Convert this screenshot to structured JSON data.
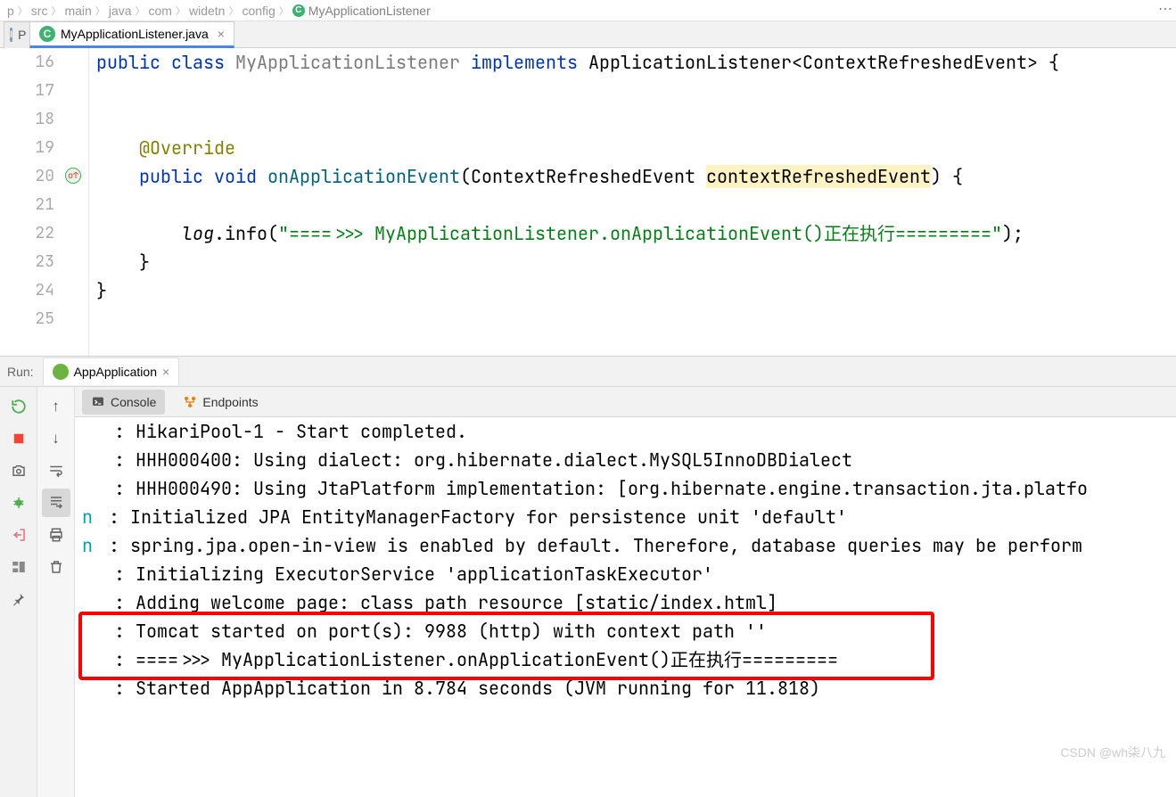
{
  "breadcrumb": {
    "items": [
      "p",
      "src",
      "main",
      "java",
      "com",
      "widetn",
      "config",
      "MyApplicationListener"
    ]
  },
  "tabs": {
    "inactive_label": "P",
    "active_file": "MyApplicationListener.java"
  },
  "editor": {
    "lines": [
      {
        "n": "16",
        "ind": "",
        "t": [
          [
            "kw",
            "public"
          ],
          [
            "sp",
            " "
          ],
          [
            "kw",
            "class"
          ],
          [
            "sp",
            " "
          ],
          [
            "cls",
            "MyApplicationListener"
          ],
          [
            "sp",
            " "
          ],
          [
            "kw",
            "implements"
          ],
          [
            "sp",
            " "
          ],
          [
            "p",
            "ApplicationListener<ContextRefreshedEvent> {"
          ]
        ]
      },
      {
        "n": "17",
        "ind": "",
        "t": []
      },
      {
        "n": "18",
        "ind": "",
        "t": []
      },
      {
        "n": "19",
        "ind": "    ",
        "t": [
          [
            "ann",
            "@Override"
          ]
        ]
      },
      {
        "n": "20",
        "ind": "    ",
        "t": [
          [
            "kw",
            "public"
          ],
          [
            "sp",
            " "
          ],
          [
            "kw",
            "void"
          ],
          [
            "sp",
            " "
          ],
          [
            "mname",
            "onApplicationEvent"
          ],
          [
            "p",
            "(ContextRefreshedEvent "
          ],
          [
            "hl",
            "contextRefreshedEvent"
          ],
          [
            "p",
            ") {"
          ]
        ],
        "override": true
      },
      {
        "n": "21",
        "ind": "",
        "t": []
      },
      {
        "n": "22",
        "ind": "        ",
        "t": [
          [
            "local",
            "log"
          ],
          [
            "p",
            ".info("
          ],
          [
            "str",
            "\"====>>> MyApplicationListener.onApplicationEvent()"
          ],
          [
            "strcn",
            "正在执行"
          ],
          [
            "str",
            "=========\""
          ],
          [
            "p",
            ");"
          ]
        ]
      },
      {
        "n": "23",
        "ind": "    ",
        "t": [
          [
            "p",
            "}"
          ]
        ]
      },
      {
        "n": "24",
        "ind": "",
        "t": [
          [
            "p",
            "}"
          ]
        ]
      },
      {
        "n": "25",
        "ind": "",
        "t": []
      }
    ]
  },
  "run": {
    "label": "Run:",
    "config": "AppApplication",
    "console_tab": "Console",
    "endpoints_tab": "Endpoints"
  },
  "console": {
    "lines": [
      " : HikariPool-1 - Start completed.",
      " : HHH000400: Using dialect: org.hibernate.dialect.MySQL5InnoDBDialect",
      " : HHH000490: Using JtaPlatform implementation: [org.hibernate.engine.transaction.jta.platfo",
      " : Initialized JPA EntityManagerFactory for persistence unit 'default'",
      " : spring.jpa.open-in-view is enabled by default. Therefore, database queries may be perform",
      " : Initializing ExecutorService 'applicationTaskExecutor'",
      " : Adding welcome page: class path resource [static/index.html]",
      " : Tomcat started on port(s): 9988 (http) with context path ''",
      " : ====>>> MyApplicationListener.onApplicationEvent()正在执行=========",
      " : Started AppApplication in 8.784 seconds (JVM running for 11.818)"
    ],
    "prefixes": [
      "",
      "",
      "",
      "n",
      "n",
      "",
      "",
      "",
      "",
      ""
    ]
  },
  "watermark": "CSDN @wh柒八九"
}
